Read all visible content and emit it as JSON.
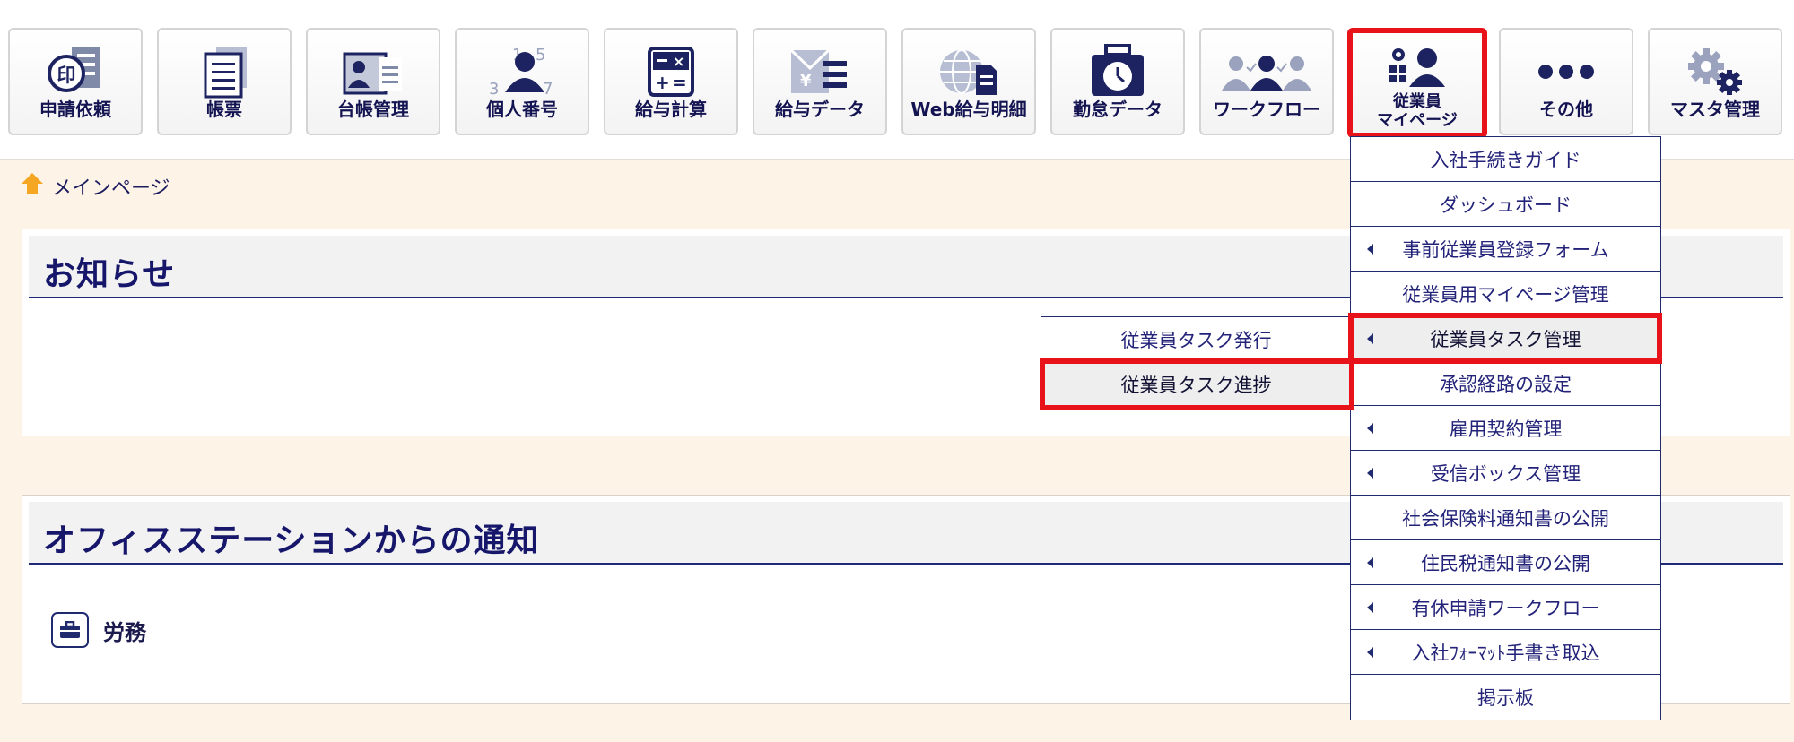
{
  "nav": [
    {
      "label": "申請依頼",
      "icon": "seal-document-icon"
    },
    {
      "label": "帳票",
      "icon": "report-document-icon"
    },
    {
      "label": "台帳管理",
      "icon": "ledger-card-icon"
    },
    {
      "label": "個人番号",
      "icon": "personal-number-icon"
    },
    {
      "label": "給与計算",
      "icon": "calculator-icon"
    },
    {
      "label": "給与データ",
      "icon": "salary-data-icon"
    },
    {
      "label": "Web給与明細",
      "icon": "web-globe-document-icon"
    },
    {
      "label": "勤怠データ",
      "icon": "attendance-clock-icon"
    },
    {
      "label": "ワークフロー",
      "icon": "workflow-people-icon"
    },
    {
      "label_line1": "従業員",
      "label_line2": "マイページ",
      "icon": "employee-mypage-icon"
    },
    {
      "label": "その他",
      "icon": "more-dots-icon"
    },
    {
      "label": "マスタ管理",
      "icon": "gears-icon"
    }
  ],
  "breadcrumb": {
    "label": "メインページ",
    "icon": "home-icon"
  },
  "panels": {
    "notice_title": "お知らせ",
    "office_title": "オフィスステーションからの通知",
    "labor_label": "労務"
  },
  "dropdown": [
    {
      "label": "入社手続きガイド",
      "has_submenu": false
    },
    {
      "label": "ダッシュボード",
      "has_submenu": false
    },
    {
      "label": "事前従業員登録フォーム",
      "has_submenu": true
    },
    {
      "label": "従業員用マイページ管理",
      "has_submenu": false
    },
    {
      "label": "従業員タスク管理",
      "has_submenu": true,
      "selected": true
    },
    {
      "label": "承認経路の設定",
      "has_submenu": false
    },
    {
      "label": "雇用契約管理",
      "has_submenu": true
    },
    {
      "label": "受信ボックス管理",
      "has_submenu": true
    },
    {
      "label": "社会保険料通知書の公開",
      "has_submenu": false
    },
    {
      "label": "住民税通知書の公開",
      "has_submenu": true
    },
    {
      "label": "有休申請ワークフロー",
      "has_submenu": true
    },
    {
      "label": "入社ﾌｫｰﾏｯﾄ手書き取込",
      "has_submenu": true
    },
    {
      "label": "掲示板",
      "has_submenu": false
    }
  ],
  "submenu": [
    {
      "label": "従業員タスク発行"
    },
    {
      "label": "従業員タスク進捗",
      "selected": true
    }
  ],
  "colors": {
    "highlight": "#e8121a",
    "navy": "#1f2a6f",
    "page_bg": "#fdf3e6",
    "home_icon": "#f5a623"
  }
}
